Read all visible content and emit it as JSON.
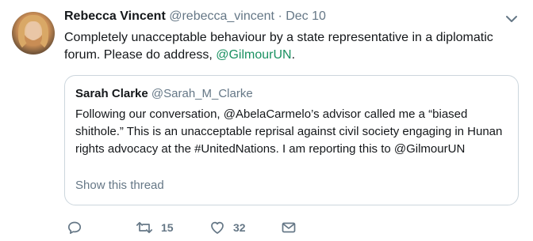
{
  "tweet": {
    "author_name": "Rebecca Vincent",
    "author_handle": "@rebecca_vincent",
    "separator": "·",
    "date": "Dec 10",
    "text_before": "Completely unacceptable behaviour by a state representative in a diplomatic forum. Please do address, ",
    "mention": "@GilmourUN",
    "text_after": "."
  },
  "quoted": {
    "author_name": "Sarah Clarke",
    "author_handle": "@Sarah_M_Clarke",
    "text": "Following our conversation, @AbelaCarmelo’s advisor called me a “biased shithole.” This is an unacceptable reprisal against civil society engaging in Hunan rights advocacy at the #UnitedNations. I am reporting this to @GilmourUN",
    "show_thread_label": "Show this thread"
  },
  "actions": {
    "reply_icon": "reply-icon",
    "retweet_icon": "retweet-icon",
    "retweet_count": "15",
    "like_icon": "heart-icon",
    "like_count": "32",
    "dm_icon": "envelope-icon"
  },
  "colors": {
    "mention": "#1a9161",
    "secondary_text": "#657786",
    "border": "#ccd6dd"
  }
}
